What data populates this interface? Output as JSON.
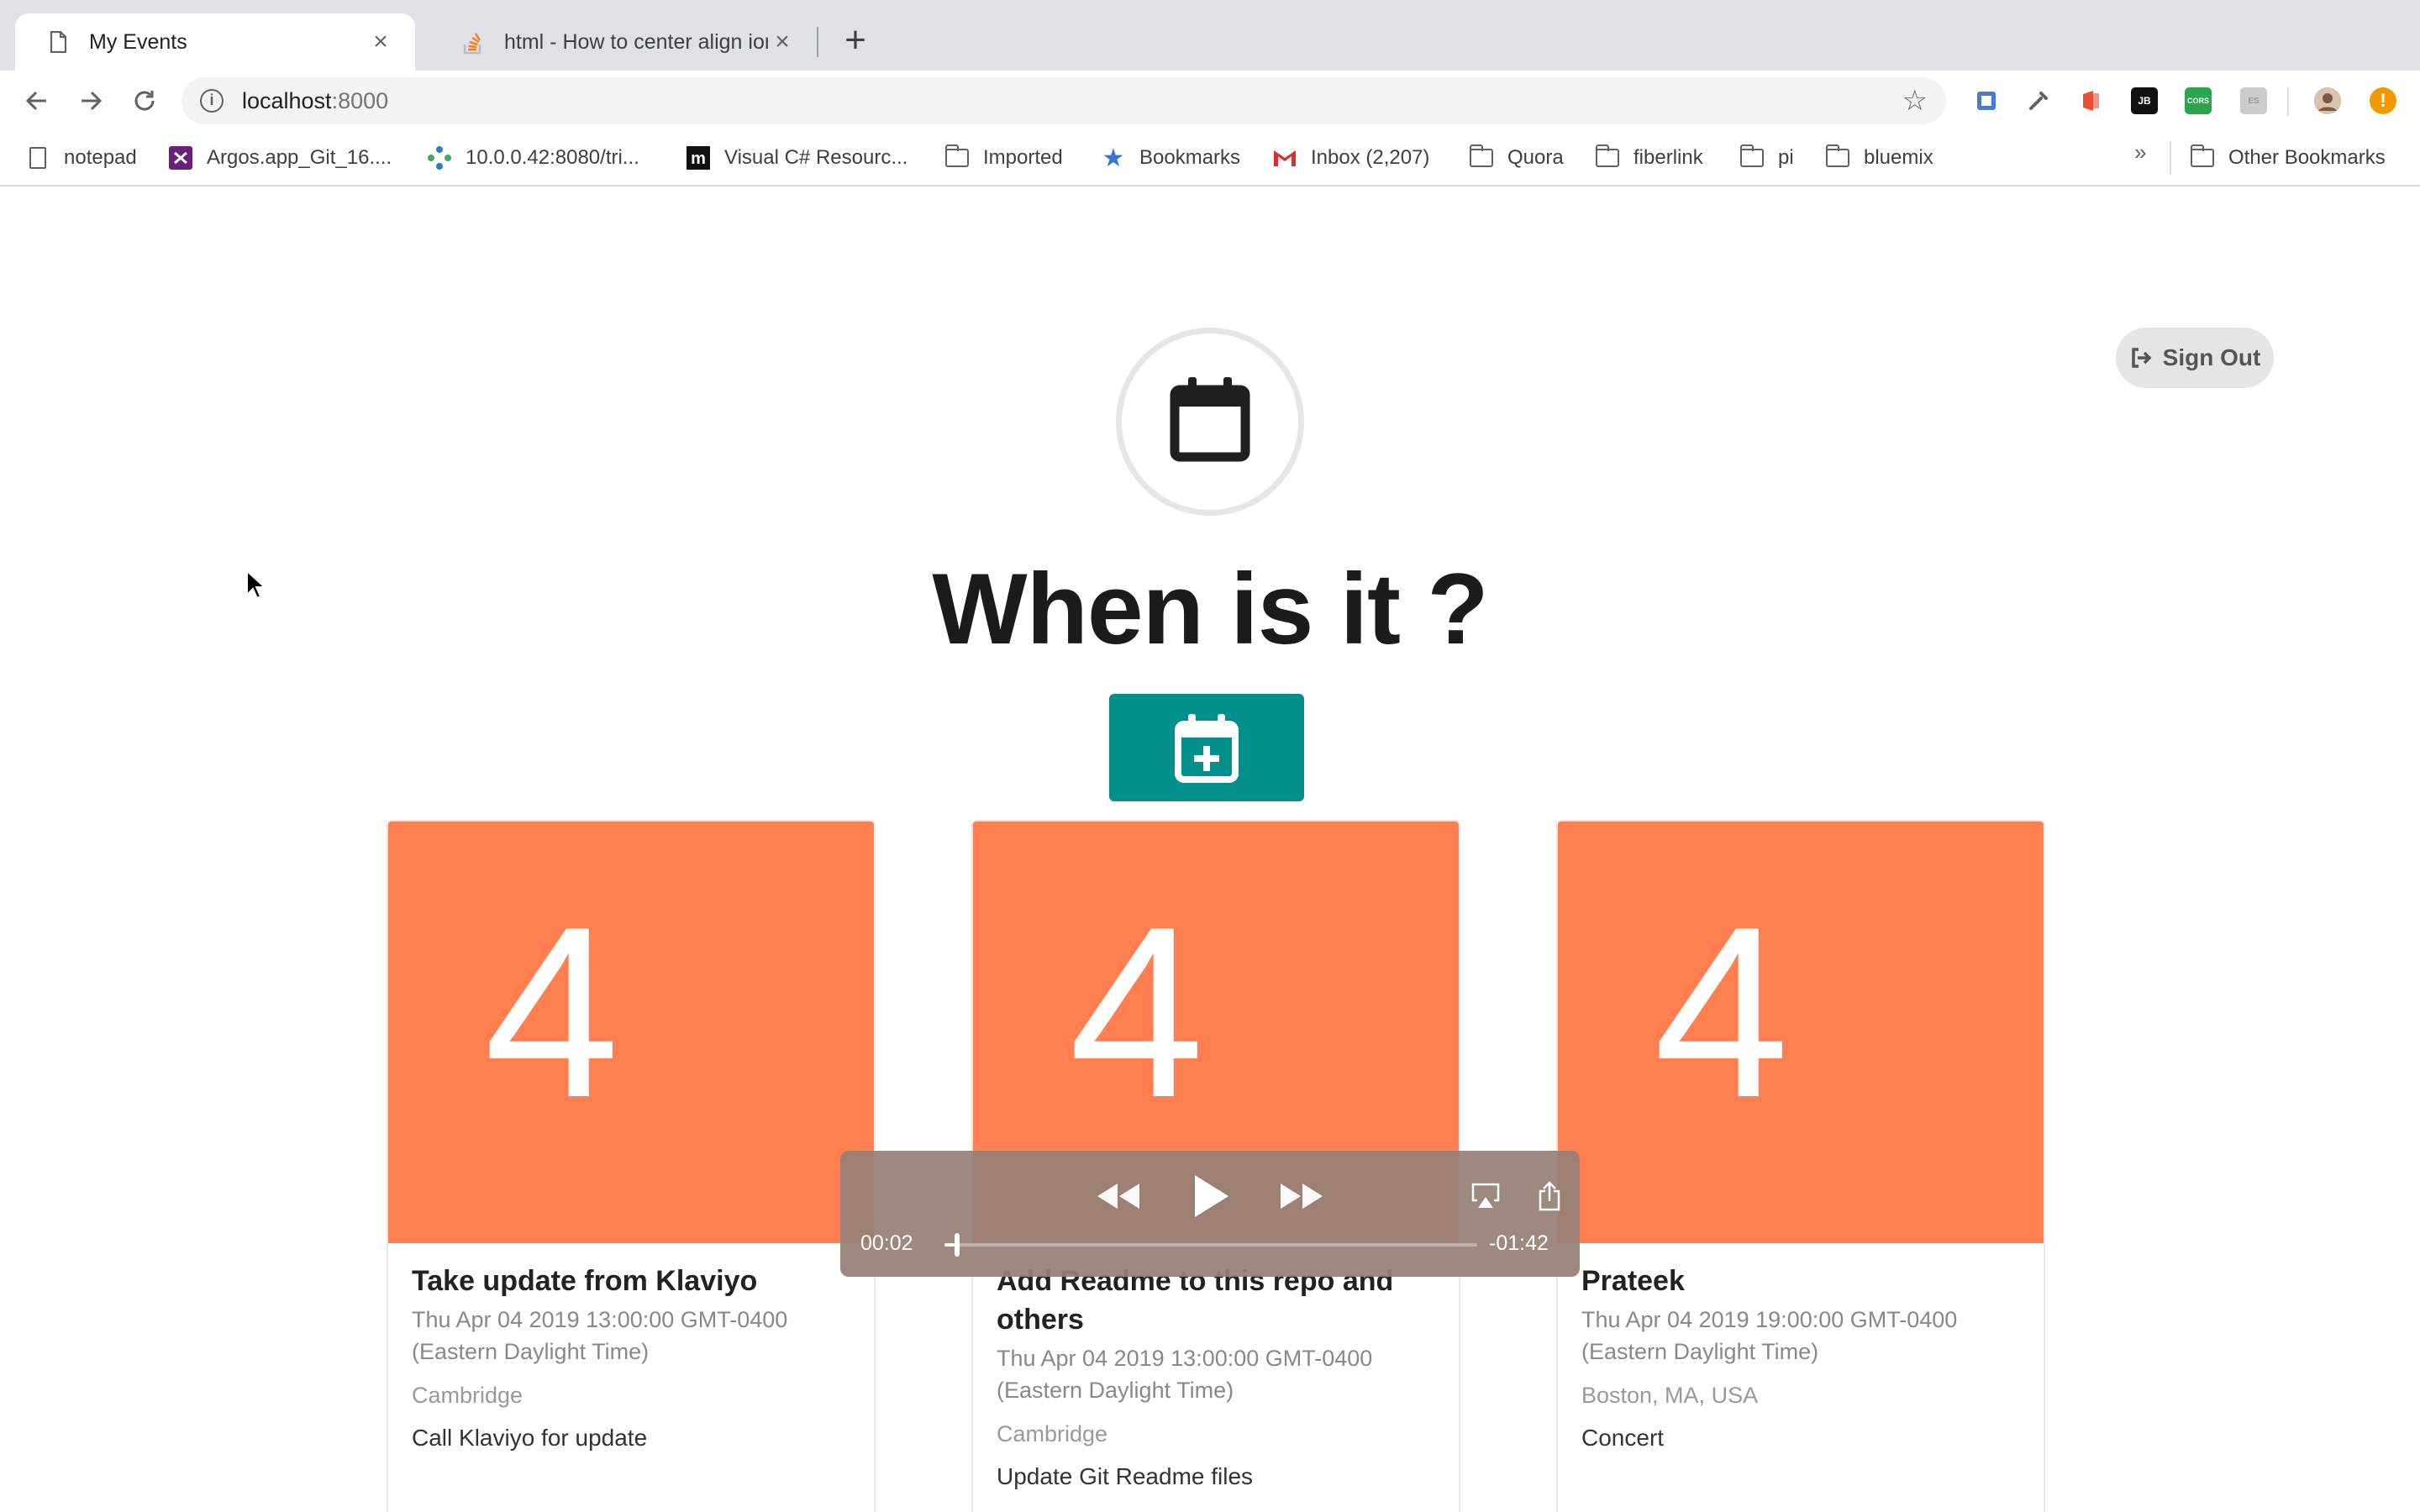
{
  "browser": {
    "tabs": [
      {
        "title": "My Events",
        "active": true,
        "icon": "page-icon"
      },
      {
        "title": "html - How to center align ion i",
        "active": false,
        "icon": "stackoverflow-icon"
      }
    ],
    "address": {
      "host": "localhost",
      "port": ":8000"
    },
    "bookmarks": [
      {
        "label": "notepad",
        "icon": "page-icon"
      },
      {
        "label": "Argos.app_Git_16....",
        "icon": "visual-studio-icon"
      },
      {
        "label": "10.0.0.42:8080/tri...",
        "icon": "network-icon"
      },
      {
        "label": "Visual C# Resourc...",
        "icon": "m-logo-icon"
      },
      {
        "label": "Imported",
        "icon": "folder-icon"
      },
      {
        "label": "Bookmarks",
        "icon": "star-icon"
      },
      {
        "label": "Inbox (2,207)",
        "icon": "gmail-icon"
      },
      {
        "label": "Quora",
        "icon": "folder-icon"
      },
      {
        "label": "fiberlink",
        "icon": "folder-icon"
      },
      {
        "label": "pi",
        "icon": "folder-icon"
      },
      {
        "label": "bluemix",
        "icon": "folder-icon"
      }
    ],
    "overflow_label": "»",
    "other_bookmarks": "Other Bookmarks",
    "extensions": [
      {
        "label": "",
        "color": "#4a7cc9"
      },
      {
        "label": "",
        "color": "#5f6368"
      },
      {
        "label": "",
        "color": "#e8502f"
      },
      {
        "label": "JB",
        "color": "#111111"
      },
      {
        "label": "CORS",
        "color": "#2ea44f"
      },
      {
        "label": "ES",
        "color": "#cccccc"
      }
    ]
  },
  "page": {
    "headline": "When is it ?",
    "signout_label": "Sign Out",
    "accent_color": "#03908c",
    "card_color": "#ff7f50"
  },
  "events": [
    {
      "day": "4",
      "title": "Take update from Klaviyo",
      "date": "Thu Apr 04 2019 13:00:00 GMT-0400 (Eastern Daylight Time)",
      "location": "Cambridge",
      "description": "Call Klaviyo for update"
    },
    {
      "day": "4",
      "title": "Add Readme to this repo and others",
      "date": "Thu Apr 04 2019 13:00:00 GMT-0400 (Eastern Daylight Time)",
      "location": "Cambridge",
      "description": "Update Git Readme files"
    },
    {
      "day": "4",
      "title": "Prateek",
      "date": "Thu Apr 04 2019 19:00:00 GMT-0400 (Eastern Daylight Time)",
      "location": "Boston, MA, USA",
      "description": "Concert"
    }
  ],
  "player": {
    "elapsed": "00:02",
    "remaining": "-01:42",
    "progress_fraction": 0.019
  }
}
